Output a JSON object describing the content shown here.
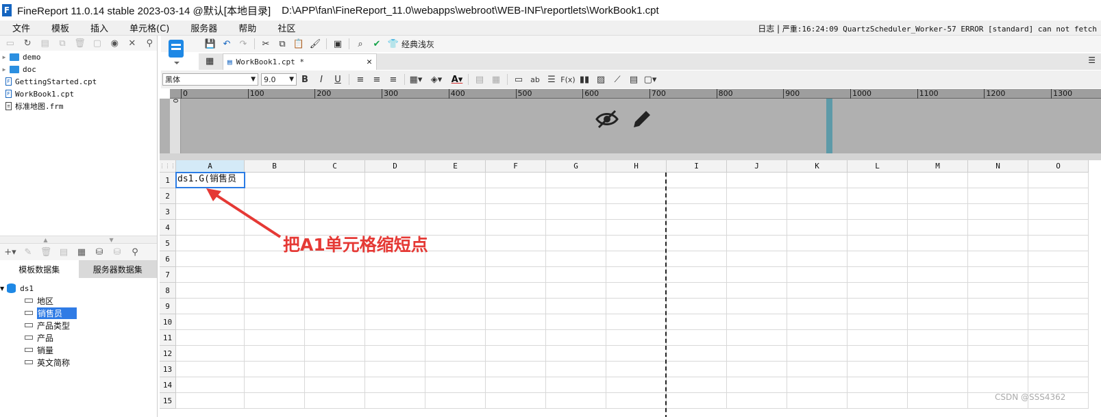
{
  "window": {
    "title": "FineReport 11.0.14 stable 2023-03-14 @默认[本地目录]",
    "path": "D:\\APP\\fan\\FineReport_11.0\\webapps\\webroot\\WEB-INF\\reportlets\\WorkBook1.cpt"
  },
  "menu": [
    "文件",
    "模板",
    "插入",
    "单元格(C)",
    "服务器",
    "帮助",
    "社区"
  ],
  "log": {
    "label": "日志",
    "text": "严重:16:24:09 QuartzScheduler_Worker-57 ERROR [standard] can not fetch"
  },
  "file_tree": [
    {
      "name": "demo",
      "type": "folder"
    },
    {
      "name": "doc",
      "type": "folder"
    },
    {
      "name": "GettingStarted.cpt",
      "type": "file"
    },
    {
      "name": "WorkBook1.cpt",
      "type": "file"
    },
    {
      "name": "标准地图.frm",
      "type": "frm"
    }
  ],
  "dataset_tabs": [
    "模板数据集",
    "服务器数据集"
  ],
  "dataset": {
    "name": "ds1",
    "fields": [
      "地区",
      "销售员",
      "产品类型",
      "产品",
      "销量",
      "英文简称"
    ],
    "selected_field": "销售员"
  },
  "toolbar": {
    "theme_label": "经典浅灰"
  },
  "tab": {
    "label": "WorkBook1.cpt *"
  },
  "format": {
    "font": "黑体",
    "size": "9.0"
  },
  "ruler": [
    "0",
    "100",
    "200",
    "300",
    "400",
    "500",
    "600",
    "700",
    "800",
    "900",
    "1000",
    "1100",
    "1200",
    "1300"
  ],
  "columns": [
    "A",
    "B",
    "C",
    "D",
    "E",
    "F",
    "G",
    "H",
    "I",
    "J",
    "K",
    "L",
    "M",
    "N",
    "O"
  ],
  "rows": [
    "1",
    "2",
    "3",
    "4",
    "5",
    "6",
    "7",
    "8",
    "9",
    "10",
    "11",
    "12",
    "13",
    "14",
    "15"
  ],
  "cells": {
    "A1": "ds1.G(销售员"
  },
  "annotation": "把A1单元格缩短点",
  "watermark": "CSDN @SSS4362",
  "colors": {
    "accent": "#2a7be4",
    "annotation": "#e53935",
    "header_band": "#b0b0b0"
  }
}
